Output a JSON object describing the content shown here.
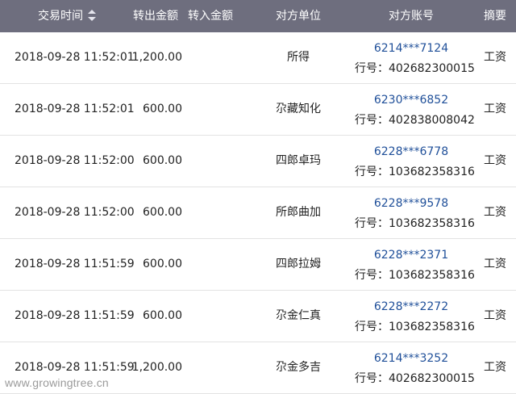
{
  "header": {
    "time": "交易时间",
    "out_amount": "转出金额",
    "in_amount": "转入金额",
    "party": "对方单位",
    "account": "对方账号",
    "memo": "摘要"
  },
  "rows": [
    {
      "time": "2018-09-28  11:52:01",
      "out": "1,200.00",
      "in": "",
      "party": "所得",
      "account": "6214***7124",
      "bank": "行号：402682300015",
      "memo": "工资"
    },
    {
      "time": "2018-09-28  11:52:01",
      "out": "600.00",
      "in": "",
      "party": "尕藏知化",
      "account": "6230***6852",
      "bank": "行号：402838008042",
      "memo": "工资"
    },
    {
      "time": "2018-09-28  11:52:00",
      "out": "600.00",
      "in": "",
      "party": "四郎卓玛",
      "account": "6228***6778",
      "bank": "行号：103682358316",
      "memo": "工资"
    },
    {
      "time": "2018-09-28  11:52:00",
      "out": "600.00",
      "in": "",
      "party": "所郎曲加",
      "account": "6228***9578",
      "bank": "行号：103682358316",
      "memo": "工资"
    },
    {
      "time": "2018-09-28  11:51:59",
      "out": "600.00",
      "in": "",
      "party": "四郎拉姆",
      "account": "6228***2371",
      "bank": "行号：103682358316",
      "memo": "工资"
    },
    {
      "time": "2018-09-28  11:51:59",
      "out": "600.00",
      "in": "",
      "party": "尕金仁真",
      "account": "6228***2272",
      "bank": "行号：103682358316",
      "memo": "工资"
    },
    {
      "time": "2018-09-28  11:51:59",
      "out": "1,200.00",
      "in": "",
      "party": "尕金多吉",
      "account": "6214***3252",
      "bank": "行号：402682300015",
      "memo": "工资"
    }
  ],
  "watermark": "www.growingtree.cn",
  "colors": {
    "header_bg": "#6e6e7e",
    "account_link": "#1f4f99"
  },
  "icons": {
    "sort": "sort-updown-icon"
  }
}
